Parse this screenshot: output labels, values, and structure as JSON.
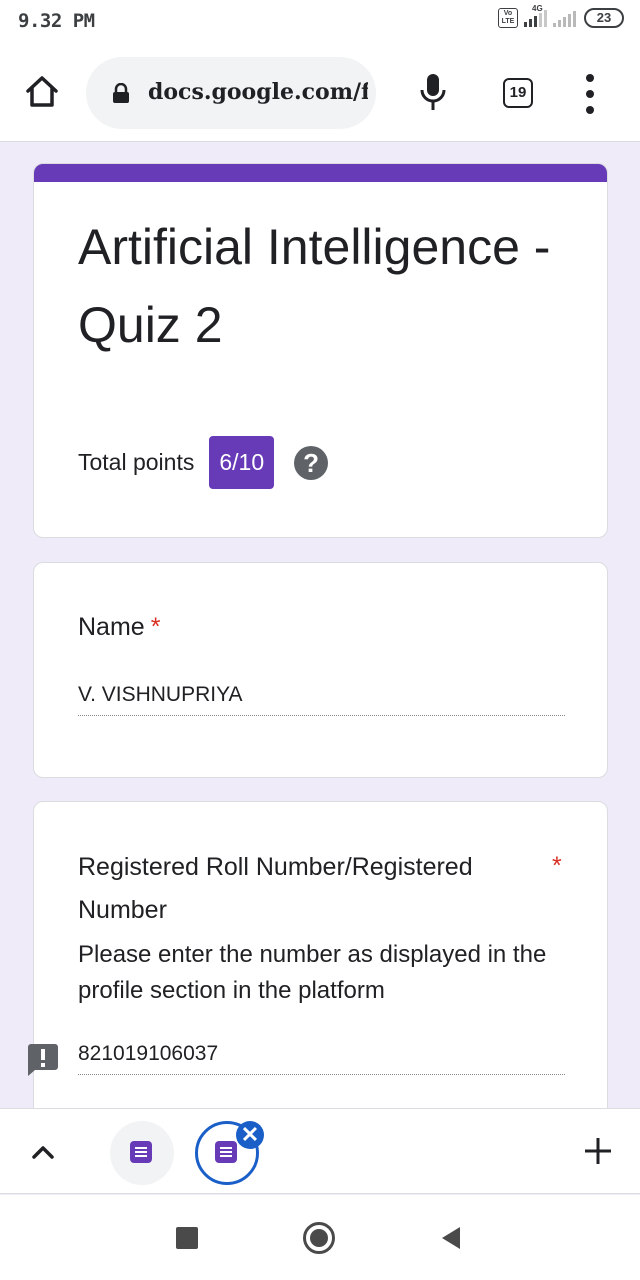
{
  "status_bar": {
    "time": "9.32 PM",
    "volte": "Vo LTE",
    "network": "4G",
    "battery": "23"
  },
  "browser": {
    "url": "docs.google.com/fi",
    "tab_count": "19",
    "icons": [
      "home-icon",
      "lock-icon",
      "mic-icon",
      "tab-switcher-icon",
      "more-vert-icon"
    ]
  },
  "form": {
    "accent_color": "#673ab7",
    "title": "Artificial Intelligence - Quiz 2",
    "total_points_label": "Total points",
    "score": "6/10",
    "help_symbol": "?"
  },
  "questions": [
    {
      "title": "Name",
      "required_mark": "*",
      "answer": "V. VISHNUPRIYA"
    },
    {
      "title": "Registered Roll Number/Registered Number",
      "required_mark": "*",
      "description": "Please enter the number as displayed in the profile section in the platform",
      "answer": "821019106037",
      "feedback_icon": "warning-icon"
    }
  ],
  "bottom_toolbar": {
    "close_symbol": "✕",
    "icons": [
      "chevron-up-icon",
      "forms-tab-icon",
      "forms-tab-icon",
      "close-icon",
      "add-icon"
    ]
  },
  "nav_bar": {
    "icons": [
      "recents-icon",
      "home-icon",
      "back-icon"
    ]
  }
}
